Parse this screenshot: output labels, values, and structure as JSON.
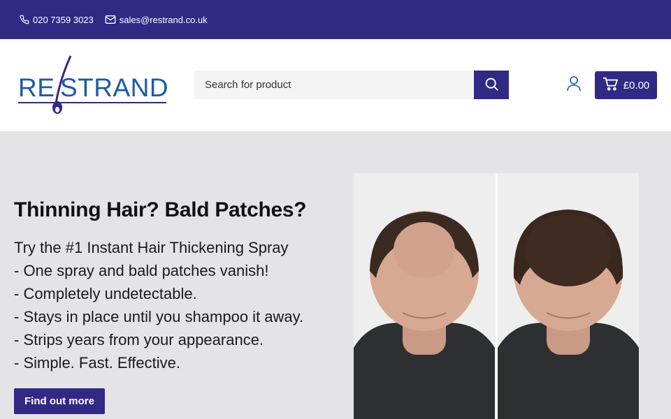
{
  "topbar": {
    "phone": "020 7359 3023",
    "email": "sales@restrand.co.uk",
    "phone_icon": "phone-icon",
    "email_icon": "mail-icon"
  },
  "header": {
    "logo_text": "RESTRAND",
    "search_placeholder": "Search for product",
    "cart_total": "£0.00",
    "icons": [
      "search-icon",
      "user-icon",
      "cart-icon"
    ]
  },
  "hero": {
    "title": "Thinning Hair? Bald Patches?",
    "lines": [
      "Try the #1 Instant Hair Thickening Spray",
      "- One spray and bald patches vanish!",
      "- Completely undetectable.",
      "- Stays in place until you shampoo it away.",
      "- Strips years from your appearance.",
      "- Simple. Fast. Effective."
    ],
    "cta_label": "Find out more"
  },
  "colors": {
    "brand": "#322985",
    "logo_blue": "#1e59a8",
    "hero_bg": "#e4e4e6"
  }
}
